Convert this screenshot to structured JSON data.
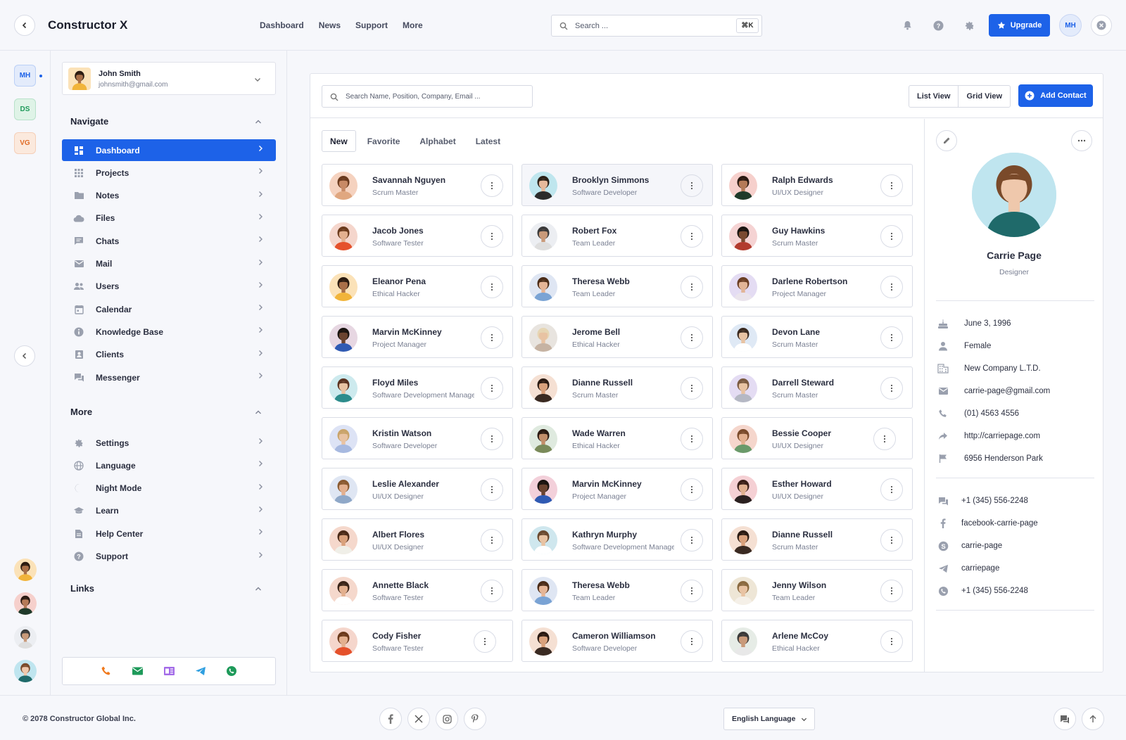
{
  "app": {
    "title": "Constructor X"
  },
  "topnav": [
    "Dashboard",
    "News",
    "Support",
    "More"
  ],
  "search": {
    "placeholder": "Search ...",
    "shortcut": "⌘K"
  },
  "upgrade_label": "Upgrade",
  "user_initials": "MH",
  "workspaces": [
    {
      "initials": "MH",
      "color": "#1d62e8",
      "bg": "#e3ebfb"
    },
    {
      "initials": "DS",
      "color": "#1e9a5a",
      "bg": "#dff3e7"
    },
    {
      "initials": "VG",
      "color": "#e06b26",
      "bg": "#fbe9dd"
    }
  ],
  "current_user": {
    "name": "John Smith",
    "email": "johnsmith@gmail.com"
  },
  "sidebar": {
    "navigate_title": "Navigate",
    "navigate_items": [
      {
        "label": "Dashboard",
        "icon": "dashboard-icon"
      },
      {
        "label": "Projects",
        "icon": "apps-icon"
      },
      {
        "label": "Notes",
        "icon": "folder-icon"
      },
      {
        "label": "Files",
        "icon": "cloud-icon"
      },
      {
        "label": "Chats",
        "icon": "chat-icon"
      },
      {
        "label": "Mail",
        "icon": "mail-icon"
      },
      {
        "label": "Users",
        "icon": "users-icon"
      },
      {
        "label": "Calendar",
        "icon": "calendar-icon"
      },
      {
        "label": "Knowledge Base",
        "icon": "info-icon"
      },
      {
        "label": "Clients",
        "icon": "client-icon"
      },
      {
        "label": "Messenger",
        "icon": "messenger-icon"
      }
    ],
    "more_title": "More",
    "more_items": [
      {
        "label": "Settings",
        "icon": "gear-icon"
      },
      {
        "label": "Language",
        "icon": "globe-icon"
      },
      {
        "label": "Night Mode",
        "icon": "moon-icon"
      },
      {
        "label": "Learn",
        "icon": "graduation-cap-icon"
      },
      {
        "label": "Help Center",
        "icon": "document-icon"
      },
      {
        "label": "Support",
        "icon": "help-icon"
      }
    ],
    "links_title": "Links"
  },
  "contacts_panel": {
    "search_placeholder": "Search Name, Position, Company, Email ...",
    "list_view": "List View",
    "grid_view": "Grid View",
    "add_contact": "Add Contact",
    "tabs": [
      "New",
      "Favorite",
      "Alphabet",
      "Latest"
    ],
    "contacts": [
      {
        "name": "Savannah Nguyen",
        "role": "Scrum Master",
        "bg": "#f5d2bf",
        "skin": "#c88a66",
        "hair": "#6a3a1e",
        "shirt": "#e0a780"
      },
      {
        "name": "Brooklyn Simmons",
        "role": "Software Developer",
        "bg": "#bfe6ee",
        "skin": "#e6b99b",
        "hair": "#2b2118",
        "shirt": "#2b2b2b"
      },
      {
        "name": "Ralph Edwards",
        "role": "UI/UX Designer",
        "bg": "#f6d0cc",
        "skin": "#b57a58",
        "hair": "#2a1a12",
        "shirt": "#1f3a2a"
      },
      {
        "name": "Jacob Jones",
        "role": "Software Tester",
        "bg": "#f5d6cc",
        "skin": "#e3b08f",
        "hair": "#6b3a1c",
        "shirt": "#e5512b"
      },
      {
        "name": "Robert Fox",
        "role": "Team Leader",
        "bg": "#eceef2",
        "skin": "#c99a7a",
        "hair": "#3a3a3a",
        "shirt": "#dedede"
      },
      {
        "name": "Guy Hawkins",
        "role": "Scrum Master",
        "bg": "#f5d3d3",
        "skin": "#7a4a30",
        "hair": "#1a1410",
        "shirt": "#b23b2e"
      },
      {
        "name": "Eleanor Pena",
        "role": "Ethical Hacker",
        "bg": "#fbe2b8",
        "skin": "#a96f48",
        "hair": "#2a1a10",
        "shirt": "#f1b43a"
      },
      {
        "name": "Theresa Webb",
        "role": "Team Leader",
        "bg": "#dfe6f3",
        "skin": "#e5b596",
        "hair": "#4a2c18",
        "shirt": "#7aa3d4"
      },
      {
        "name": "Darlene Robertson",
        "role": "Project Manager",
        "bg": "#e4dcf3",
        "skin": "#e2b597",
        "hair": "#6a3e24",
        "shirt": "#eae4ec"
      },
      {
        "name": "Marvin McKinney",
        "role": "Project Manager",
        "bg": "#e7d7e2",
        "skin": "#6b4430",
        "hair": "#1a1410",
        "shirt": "#2f5ab3"
      },
      {
        "name": "Jerome Bell",
        "role": "Ethical Hacker",
        "bg": "#e8e4df",
        "skin": "#e8c3a3",
        "hair": "#e6d6b4",
        "shirt": "#c6b3a3"
      },
      {
        "name": "Devon Lane",
        "role": "Scrum Master",
        "bg": "#dfe9f5",
        "skin": "#e8c3a3",
        "hair": "#3a2a20",
        "shirt": "#ffffff"
      },
      {
        "name": "Floyd Miles",
        "role": "Software Development Manager",
        "bg": "#cdeaee",
        "skin": "#e8c3a3",
        "hair": "#5a3220",
        "shirt": "#2d8c8c"
      },
      {
        "name": "Dianne Russell",
        "role": "Scrum Master",
        "bg": "#f5e0d3",
        "skin": "#d9a17c",
        "hair": "#2a1a12",
        "shirt": "#3a2a22"
      },
      {
        "name": "Darrell Steward",
        "role": "Scrum Master",
        "bg": "#e4dcf3",
        "skin": "#e8c3a3",
        "hair": "#7a5a40",
        "shirt": "#b5b8c4"
      },
      {
        "name": "Kristin Watson",
        "role": "Software Developer",
        "bg": "#dde3f5",
        "skin": "#e8c3a3",
        "hair": "#c9a46a",
        "shirt": "#a7b9e0"
      },
      {
        "name": "Wade Warren",
        "role": "Ethical Hacker",
        "bg": "#dfeadf",
        "skin": "#c28e6a",
        "hair": "#2a1a12",
        "shirt": "#7a8a5a"
      },
      {
        "name": "Bessie Cooper",
        "role": "UI/UX Designer",
        "bg": "#f5d6cc",
        "skin": "#e3b08f",
        "hair": "#7a4a2a",
        "shirt": "#6a9a6a"
      },
      {
        "name": "Leslie Alexander",
        "role": "UI/UX Designer",
        "bg": "#dfe6f3",
        "skin": "#e3b08f",
        "hair": "#8a5a30",
        "shirt": "#8fa8c8"
      },
      {
        "name": "Marvin McKinney",
        "role": "Project Manager",
        "bg": "#f3d0da",
        "skin": "#6b4430",
        "hair": "#1a1410",
        "shirt": "#2f5ab3"
      },
      {
        "name": "Esther Howard",
        "role": "UI/UX Designer",
        "bg": "#f5d0d4",
        "skin": "#e0b090",
        "hair": "#3a1f18",
        "shirt": "#2a2020"
      },
      {
        "name": "Albert Flores",
        "role": "UI/UX Designer",
        "bg": "#f5d8cc",
        "skin": "#d9a17c",
        "hair": "#4a2a18",
        "shirt": "#f0efe8"
      },
      {
        "name": "Kathryn Murphy",
        "role": "Software Development Manager",
        "bg": "#cfe7ee",
        "skin": "#e8c3a3",
        "hair": "#6a4a30",
        "shirt": "#ffffff"
      },
      {
        "name": "Dianne Russell",
        "role": "Scrum Master",
        "bg": "#f5e0d3",
        "skin": "#d9a17c",
        "hair": "#2a1a12",
        "shirt": "#3a2a22"
      },
      {
        "name": "Annette Black",
        "role": "Software Tester",
        "bg": "#f5d8cc",
        "skin": "#e3b08f",
        "hair": "#3a2418",
        "shirt": "#ffffff"
      },
      {
        "name": "Theresa Webb",
        "role": "Team Leader",
        "bg": "#dfe6f3",
        "skin": "#e5b596",
        "hair": "#4a2c18",
        "shirt": "#7aa3d4"
      },
      {
        "name": "Jenny Wilson",
        "role": "Team Leader",
        "bg": "#eee6d6",
        "skin": "#e8c3a3",
        "hair": "#8a6a40",
        "shirt": "#f5f0e8"
      },
      {
        "name": "Cody Fisher",
        "role": "Software Tester",
        "bg": "#f5d6cc",
        "skin": "#e3b08f",
        "hair": "#6b3a1c",
        "shirt": "#e5512b"
      },
      {
        "name": "Cameron Williamson",
        "role": "Software Developer",
        "bg": "#f5e0d3",
        "skin": "#d9a17c",
        "hair": "#2a1a12",
        "shirt": "#3a2a22"
      },
      {
        "name": "Arlene McCoy",
        "role": "Ethical Hacker",
        "bg": "#e6ece6",
        "skin": "#c99a7a",
        "hair": "#3a3a3a",
        "shirt": "#e8e8e8"
      }
    ]
  },
  "detail": {
    "name": "Carrie Page",
    "role": "Designer",
    "info": [
      {
        "icon": "cake-icon",
        "text": "June 3, 1996"
      },
      {
        "icon": "person-icon",
        "text": "Female"
      },
      {
        "icon": "building-icon",
        "text": "New Company  L.T.D."
      },
      {
        "icon": "mail-icon",
        "text": "carrie-page@gmail.com"
      },
      {
        "icon": "phone-icon",
        "text": "(01) 4563 4556"
      },
      {
        "icon": "share-icon",
        "text": "http://carriepage.com"
      },
      {
        "icon": "flag-icon",
        "text": "6956 Henderson Park"
      }
    ],
    "socials": [
      {
        "icon": "messenger-icon",
        "text": "+1 (345) 556-2248"
      },
      {
        "icon": "facebook-icon",
        "text": "facebook-carrie-page"
      },
      {
        "icon": "skype-icon",
        "text": "carrie-page"
      },
      {
        "icon": "telegram-icon",
        "text": "carriepage"
      },
      {
        "icon": "whatsapp-icon",
        "text": "+1 (345) 556-2248"
      }
    ]
  },
  "footer": {
    "copyright": "© 2078 Constructor Global Inc.",
    "language": "English Language"
  },
  "colors": {
    "accent": "#1d62e8"
  }
}
